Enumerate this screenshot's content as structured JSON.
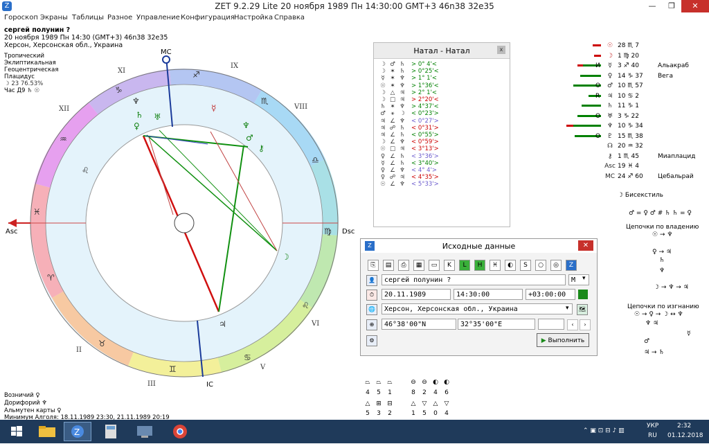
{
  "window": {
    "title": "ZET 9.2.29 Lite   20 ноября 1989  Пн  14:30:00 GMT+3 46n38  32e35",
    "min": "—",
    "max": "❐",
    "close": "✕"
  },
  "menu": [
    "Гороскоп",
    "Экраны",
    "Таблицы",
    "Разное",
    "Управление",
    "Конфигурация",
    "Настройка",
    "Справка"
  ],
  "chart_info": {
    "name": "сергей полунин ?",
    "datetime": "20 ноября 1989  Пн  14:30 (GMT+3)  46n38  32e35",
    "place": "Херсон, Херсонская обл., Украина",
    "settings": [
      "Тропический",
      "Эклиптикальная",
      "Геоцентрическая",
      "Плацидус"
    ],
    "moon_phase": "☽  23  76.53%",
    "hour": "Час Д9  ♄  ☉"
  },
  "wheel": {
    "mc": "MC",
    "ic": "IC",
    "asc": "Asc",
    "dsc": "Dsc",
    "houses": [
      "XI",
      "IX",
      "XII",
      "VIII",
      "VI",
      "II",
      "III",
      "V"
    ],
    "signs": [
      "♐",
      "♑",
      "♒",
      "♓",
      "♈",
      "♉",
      "♊",
      "♋",
      "♌",
      "♍",
      "♎",
      "♏"
    ]
  },
  "natal_panel": {
    "title": "Натал - Натал",
    "close": "x",
    "rows": [
      {
        "a": "☽",
        "b": "♂",
        "c": "♄",
        "v": "> 0° 4'<",
        "color": "#008000"
      },
      {
        "a": "☽",
        "b": "✶",
        "c": "♄",
        "v": "> 0°25'<",
        "color": "#008000"
      },
      {
        "a": "☿",
        "b": "✶",
        "c": "♆",
        "v": "> 1° 1'<",
        "color": "#008000"
      },
      {
        "a": "☉",
        "b": "✶",
        "c": "♆",
        "v": "> 1°36'<",
        "color": "#008000"
      },
      {
        "a": "☽",
        "b": "△",
        "c": "♃",
        "v": "> 2° 1'<",
        "color": "#008000"
      },
      {
        "a": "☽",
        "b": "□",
        "c": "♃",
        "v": "> 2°20'<",
        "color": "#cc0000"
      },
      {
        "a": "♄",
        "b": "✶",
        "c": "♆",
        "v": "> 4°37'<",
        "color": "#008000"
      },
      {
        "a": "♂",
        "b": "⚹",
        "c": "☽",
        "v": "< 0°23'>",
        "color": "#008000"
      },
      {
        "a": "♃",
        "b": "∠",
        "c": "♆",
        "v": "< 0°27'>",
        "color": "#6a5acd"
      },
      {
        "a": "♃",
        "b": "☍",
        "c": "♄",
        "v": "< 0°31'>",
        "color": "#cc0000"
      },
      {
        "a": "♃",
        "b": "∠",
        "c": "♄",
        "v": "< 0°55'>",
        "color": "#008000"
      },
      {
        "a": "☽",
        "b": "∠",
        "c": "♆",
        "v": "< 0°59'>",
        "color": "#cc0000"
      },
      {
        "a": "☉",
        "b": "□",
        "c": "♃",
        "v": "< 3°13'>",
        "color": "#cc0000"
      },
      {
        "a": "♀",
        "b": "∠",
        "c": "♄",
        "v": "< 3°36'>",
        "color": "#6a5acd"
      },
      {
        "a": "☿",
        "b": "∠",
        "c": "♄",
        "v": "< 3°40'>",
        "color": "#008000"
      },
      {
        "a": "♀",
        "b": "∠",
        "c": "♆",
        "v": "< 4° 4'>",
        "color": "#6a5acd"
      },
      {
        "a": "♀",
        "b": "☍",
        "c": "♃",
        "v": "< 4°35'>",
        "color": "#cc0000"
      },
      {
        "a": "☉",
        "b": "∠",
        "c": "♆",
        "v": "< 5°33'>",
        "color": "#6a5acd"
      }
    ]
  },
  "dialog": {
    "title": "Исходные данные",
    "close": "✕",
    "name_value": "сергей полунин ?",
    "sex": "M",
    "date": "20.11.1989",
    "time": "14:30:00",
    "tz": "+03:00:00",
    "place": "Херсон, Херсонская обл., Украина",
    "lat": "46°38'00\"N",
    "lon": "32°35'00\"E",
    "ok": "Выполнить",
    "toolbar": [
      "⎘",
      "▤",
      "⎙",
      "▦",
      "▭",
      "K",
      "L",
      "H",
      "♓",
      "◐",
      "S",
      "○",
      "◎",
      "Z"
    ]
  },
  "planets": [
    {
      "g": "☉",
      "v": "28 ♏ 7",
      "bars": [
        {
          "w": 12,
          "c": "#cc0000"
        }
      ]
    },
    {
      "g": "☽",
      "v": "1 ♍ 20",
      "bars": [
        {
          "w": 10,
          "c": "#cc0000"
        }
      ]
    },
    {
      "g": "☿",
      "v": "3 ♐ 40",
      "bars": [
        {
          "w": 26,
          "c": "#008000"
        },
        {
          "w": 8,
          "c": "#cc0000"
        }
      ],
      "mark": "И"
    },
    {
      "g": "♀",
      "v": "14 ♑ 37",
      "bars": [
        {
          "w": 30,
          "c": "#008000"
        }
      ]
    },
    {
      "g": "♂",
      "v": "10 ♏ 57",
      "bars": [
        {
          "w": 40,
          "c": "#008000"
        }
      ],
      "mark": "О"
    },
    {
      "g": "♃",
      "v": "10 ♋ 2",
      "bars": [
        {
          "w": 18,
          "c": "#008000"
        }
      ],
      "mark": "R"
    },
    {
      "g": "♄",
      "v": "11 ♑ 1",
      "bars": [
        {
          "w": 28,
          "c": "#008000"
        }
      ]
    },
    {
      "g": "♅",
      "v": "3 ♑ 22",
      "bars": [
        {
          "w": 34,
          "c": "#008000"
        }
      ],
      "mark": "О"
    },
    {
      "g": "♆",
      "v": "10 ♑ 34",
      "bars": [
        {
          "w": 40,
          "c": "#008000"
        },
        {
          "w": 10,
          "c": "#cc0000"
        }
      ]
    },
    {
      "g": "♇",
      "v": "15 ♏ 38",
      "bars": [
        {
          "w": 38,
          "c": "#008000"
        }
      ],
      "mark": "О"
    },
    {
      "g": "☊",
      "v": "20 ♒ 32",
      "bars": []
    },
    {
      "g": "⚷",
      "v": "1 ♏ 45",
      "bars": []
    },
    {
      "g": "Asc",
      "v": "19 ♓ 4",
      "bars": []
    },
    {
      "g": "MC",
      "v": "24 ♐ 60",
      "bars": []
    }
  ],
  "stars": [
    {
      "name": "Альакраб",
      "row": 2
    },
    {
      "name": "Вега",
      "row": 3
    },
    {
      "name": "Миаплацид",
      "row": 11
    },
    {
      "name": "Цебальрай",
      "row": 13
    }
  ],
  "right_extra": {
    "bisextile": "☽  Бисекстиль",
    "relations": "♂ = ♀ ♂ # ♄ ♄ = ♀",
    "chains_own": "Цепочки по владению",
    "chain1": "☉ → ♆",
    "chain2": "♀ → ♃",
    "chains_exile": "Цепочки по изгнанию",
    "chain3": "☉ → ♀ → ☽ ↔ ♆"
  },
  "bottom_left": {
    "line1": "Возничий  ♀",
    "line2": "Дорифорий  ♆",
    "line3": "Альмутен карты  ♀",
    "line4": "Минимум Алголя: 18.11.1989 23:30,  21.11.1989 20:19"
  },
  "stats": {
    "top_vals": [
      "4",
      "5",
      "1",
      "8",
      "2",
      "4",
      "6"
    ],
    "bot_vals": [
      "5",
      "3",
      "2",
      "1",
      "5",
      "0",
      "4"
    ]
  },
  "tray": {
    "lang": "УКР",
    "lang2": "RU",
    "time": "2:32",
    "date": "01.12.2018"
  }
}
